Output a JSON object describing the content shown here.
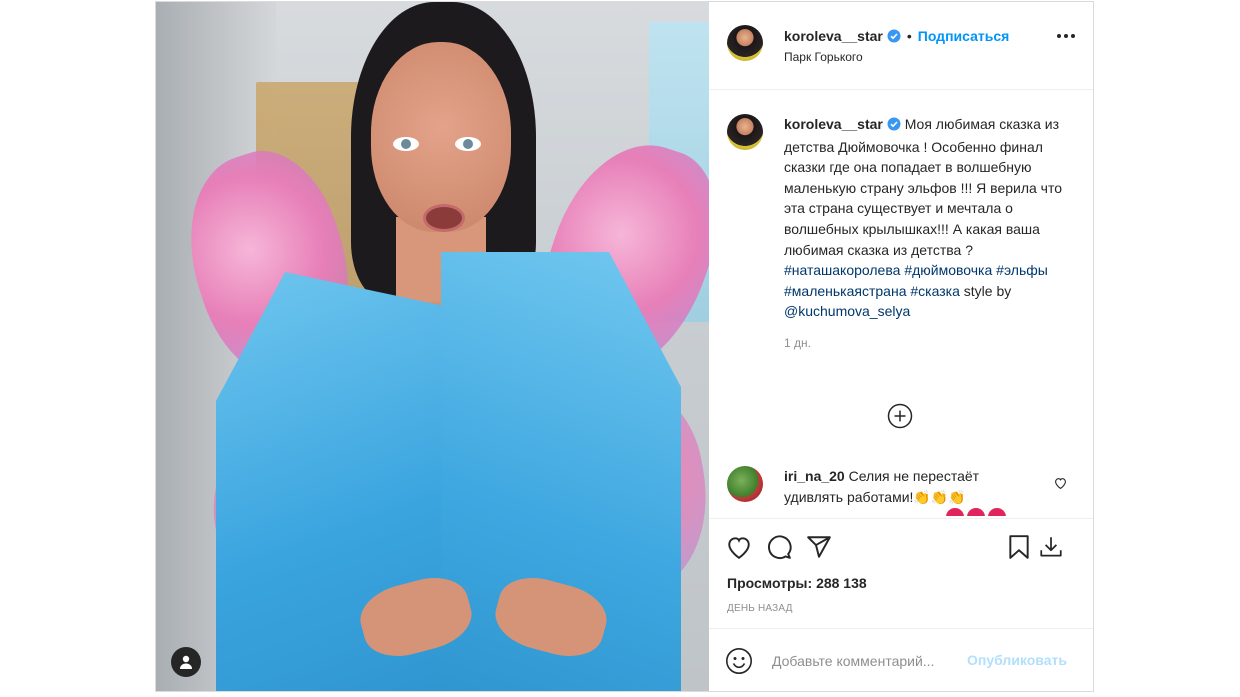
{
  "post": {
    "author": {
      "username": "koroleva__star",
      "verified": true,
      "follow_label": "Подписаться",
      "separator": "•",
      "location": "Парк Горького"
    },
    "caption": {
      "username": "koroleva__star",
      "text": "Моя любимая сказка из детства Дюймовочка ! Особенно финал сказки где она попадает в волшебную маленькую страну эльфов !!! Я верила что эта страна существует и мечтала о волшебных крылышках!!! А какая ваша любимая сказка из детства ?",
      "hashtags": [
        "#наташакоролева",
        "#дюймовочка",
        "#эльфы",
        "#маленькаястрана",
        "#сказка"
      ],
      "style_prefix": "style by",
      "style_mention": "@kuchumova_selya",
      "time": "1 дн."
    },
    "comments": [
      {
        "username": "iri_na_20",
        "text": "Селия не перестаёт удивлять работами!👏👏👏"
      }
    ],
    "views_label": "Просмотры:",
    "views_count": "288 138",
    "date_label": "ДЕНЬ НАЗАД",
    "add_comment": {
      "placeholder": "Добавьте комментарий...",
      "publish_label": "Опубликовать"
    }
  },
  "icons": {
    "verified": "verified-badge-icon",
    "more": "more-options-icon",
    "load_more": "load-more-comments-icon",
    "like": "heart-icon",
    "comment": "comment-bubble-icon",
    "share": "paper-plane-icon",
    "save": "bookmark-icon",
    "download": "download-icon",
    "emoji": "smiley-icon",
    "user_tag": "user-tag-icon"
  },
  "colors": {
    "link_blue": "#0095f6",
    "hashtag": "#00376b",
    "muted": "#8e8e8e",
    "publish_disabled": "#b2dffc",
    "border": "#dbdbdb"
  }
}
